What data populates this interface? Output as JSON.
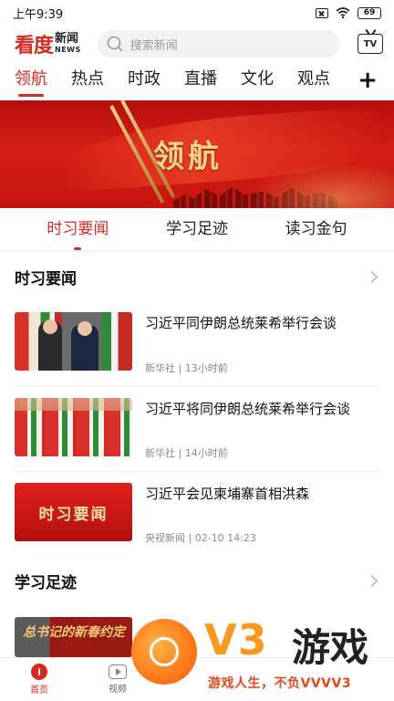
{
  "status_bar": {
    "time": "上午9:39",
    "battery": "69"
  },
  "header": {
    "logo_main": "看度",
    "logo_cn": "新闻",
    "logo_en": "NEWS",
    "search_placeholder": "搜索新闻",
    "tv_label": "TV"
  },
  "channel_tabs": [
    {
      "label": "领航",
      "active": true
    },
    {
      "label": "热点"
    },
    {
      "label": "时政"
    },
    {
      "label": "直播"
    },
    {
      "label": "文化"
    },
    {
      "label": "观点"
    }
  ],
  "add_channel": "+",
  "banner": {
    "title": "领航"
  },
  "sub_tabs": [
    {
      "label": "时习要闻",
      "active": true
    },
    {
      "label": "学习足迹"
    },
    {
      "label": "读习金句"
    }
  ],
  "sections": [
    {
      "title": "时习要闻",
      "items": [
        {
          "title": "习近平同伊朗总统莱希举行会谈",
          "source": "新华社",
          "time": "13小时前"
        },
        {
          "title": "习近平将同伊朗总统莱希举行会谈",
          "source": "新华社",
          "time": "14小时前"
        },
        {
          "title": "习近平会见柬埔寨首相洪森",
          "source": "央视新闻",
          "time": "02-10 14:23",
          "thumb_text": "时习要闻"
        }
      ]
    },
    {
      "title": "学习足迹",
      "thumb_text": "总书记的新春约定"
    }
  ],
  "bottom_nav": [
    {
      "label": "首页",
      "active": true,
      "icon": "home-icon"
    },
    {
      "label": "视频",
      "icon": "video-icon"
    }
  ],
  "watermark": {
    "brand": "V3",
    "game": "游戏",
    "slogan": "游戏人生，不负VVVV3"
  },
  "colors": {
    "accent": "#d9281f",
    "banner": "#c5140f",
    "watermark_orange": "#f79a1e"
  }
}
